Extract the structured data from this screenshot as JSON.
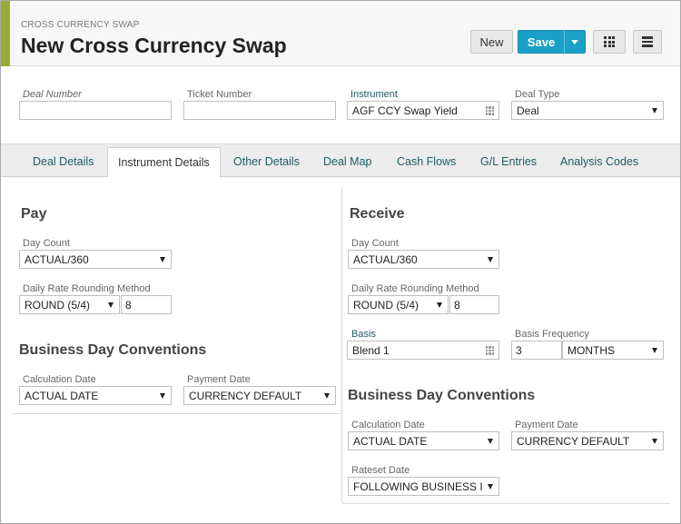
{
  "header": {
    "breadcrumb": "CROSS CURRENCY SWAP",
    "title": "New Cross Currency Swap",
    "new_label": "New",
    "save_label": "Save"
  },
  "top_fields": {
    "deal_number_label": "Deal Number",
    "deal_number_value": "",
    "ticket_number_label": "Ticket Number",
    "ticket_number_value": "",
    "instrument_label": "Instrument",
    "instrument_value": "AGF CCY Swap Yield",
    "deal_type_label": "Deal Type",
    "deal_type_value": "Deal"
  },
  "tabs": [
    {
      "label": "Deal Details"
    },
    {
      "label": "Instrument Details"
    },
    {
      "label": "Other Details"
    },
    {
      "label": "Deal Map"
    },
    {
      "label": "Cash Flows"
    },
    {
      "label": "G/L Entries"
    },
    {
      "label": "Analysis Codes"
    }
  ],
  "active_tab": "Instrument Details",
  "pay": {
    "title": "Pay",
    "day_count_label": "Day Count",
    "day_count_value": "ACTUAL/360",
    "rounding_label": "Daily Rate Rounding Method",
    "rounding_value": "ROUND (5/4)",
    "rounding_digits": "8",
    "bdc_title": "Business Day Conventions",
    "calc_date_label": "Calculation Date",
    "calc_date_value": "ACTUAL DATE",
    "payment_date_label": "Payment Date",
    "payment_date_value": "CURRENCY DEFAULT"
  },
  "receive": {
    "title": "Receive",
    "day_count_label": "Day Count",
    "day_count_value": "ACTUAL/360",
    "rounding_label": "Daily Rate Rounding Method",
    "rounding_value": "ROUND (5/4)",
    "rounding_digits": "8",
    "basis_label": "Basis",
    "basis_value": "Blend 1",
    "basis_freq_label": "Basis Frequency",
    "basis_freq_num": "3",
    "basis_freq_unit": "MONTHS",
    "bdc_title": "Business Day Conventions",
    "calc_date_label": "Calculation Date",
    "calc_date_value": "ACTUAL DATE",
    "payment_date_label": "Payment Date",
    "payment_date_value": "CURRENCY DEFAULT",
    "reset_date_label": "Rateset Date",
    "reset_date_value": "FOLLOWING BUSINESS I"
  },
  "colors": {
    "accent": "#9bab3a",
    "primary_button": "#1ba1c7",
    "tab_text": "#1f5c62"
  }
}
